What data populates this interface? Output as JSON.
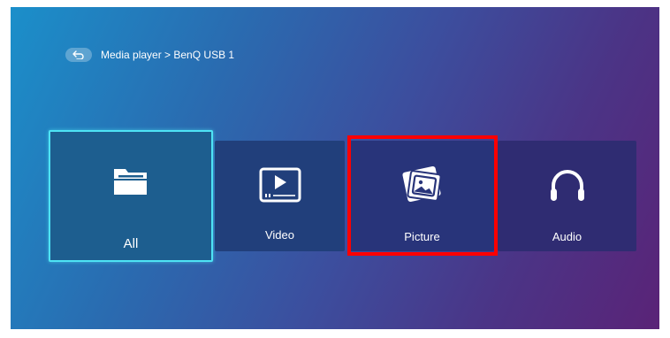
{
  "breadcrumb": {
    "back_icon": "back-arrow-icon",
    "path": "Media player > BenQ USB 1"
  },
  "tiles": [
    {
      "label": "All",
      "icon": "folder-icon",
      "selected": true
    },
    {
      "label": "Video",
      "icon": "video-player-icon",
      "selected": false
    },
    {
      "label": "Picture",
      "icon": "picture-icon",
      "selected": false
    },
    {
      "label": "Audio",
      "icon": "headphones-icon",
      "selected": false
    }
  ],
  "colors": {
    "focus_border": "#4ee3f4",
    "highlight_box": "#ff0000"
  }
}
